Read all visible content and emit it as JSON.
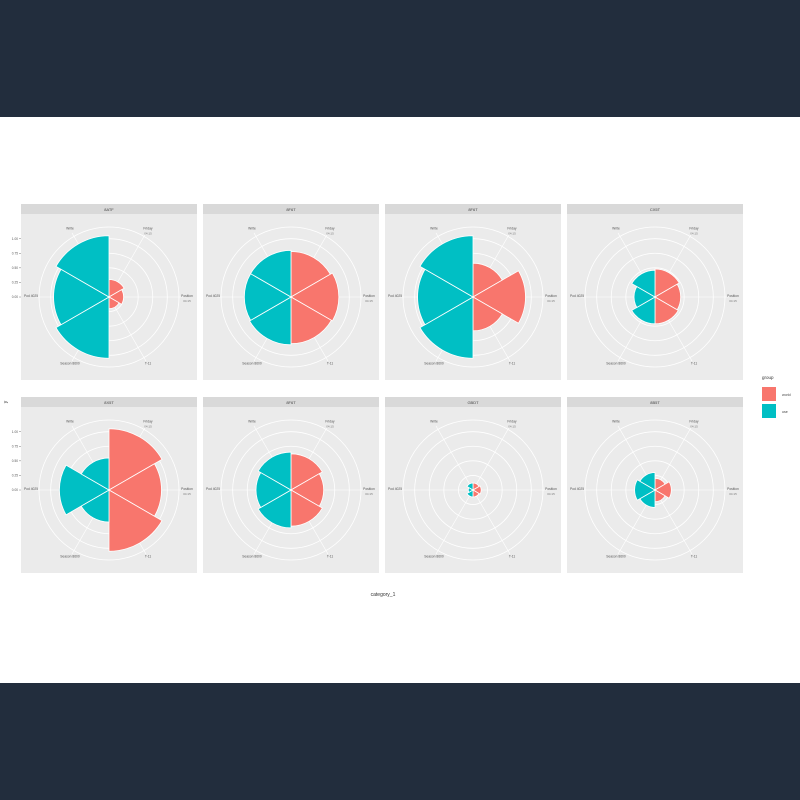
{
  "colors": {
    "page_background": "#222d3d",
    "panel_background": "#ebebeb",
    "strip_background": "#d9d9d9",
    "gridline": "#ffffff",
    "series_a": "#f8766d",
    "series_b": "#00bfc4"
  },
  "chart_data": {
    "type": "polar bar (coxcomb), faceted 2x4",
    "xlabel": "category_1",
    "ylabel": "y",
    "radial_ticks": [
      "0.00",
      "0.25",
      "0.50",
      "0.75",
      "1.00"
    ],
    "ylim": [
      0,
      1.2
    ],
    "legend": {
      "title": "group",
      "placement": "right",
      "entries": [
        {
          "label": "world",
          "color": "#f8766d"
        },
        {
          "label": "use",
          "color": "#00bfc4"
        }
      ]
    },
    "angular_labels": [
      {
        "label": "Friday",
        "sublabel": "04:15"
      },
      {
        "label": "Position",
        "sublabel": "04:15"
      },
      {
        "label": "T-11",
        "sublabel": ""
      },
      {
        "label": "Season 8600",
        "sublabel": ""
      },
      {
        "label": "Pod 4025",
        "sublabel": ""
      },
      {
        "label": "Write",
        "sublabel": ""
      }
    ],
    "categories": [
      "Friday",
      "Position",
      "T-11",
      "Season 8600",
      "Pod 4025",
      "Write"
    ],
    "facets": [
      {
        "title": "8ATF",
        "series": [
          {
            "name": "world",
            "values": [
              0.3,
              0.25,
              0.2,
              0,
              0,
              0
            ]
          },
          {
            "name": "use",
            "values": [
              0,
              0,
              0,
              1.05,
              0.95,
              1.05
            ]
          }
        ]
      },
      {
        "title": "8F6T",
        "series": [
          {
            "name": "world",
            "values": [
              0.78,
              0.82,
              0.8,
              0,
              0,
              0
            ]
          },
          {
            "name": "use",
            "values": [
              0,
              0,
              0,
              0.82,
              0.8,
              0.8
            ]
          }
        ]
      },
      {
        "title": "8F6T",
        "series": [
          {
            "name": "world",
            "values": [
              0.58,
              0.9,
              0.58,
              0,
              0,
              0
            ]
          },
          {
            "name": "use",
            "values": [
              0,
              0,
              0,
              1.05,
              0.95,
              1.05
            ]
          }
        ]
      },
      {
        "title": "CX5T",
        "series": [
          {
            "name": "world",
            "values": [
              0.48,
              0.44,
              0.46,
              0,
              0,
              0
            ]
          },
          {
            "name": "use",
            "values": [
              0,
              0,
              0,
              0.46,
              0.36,
              0.46
            ]
          }
        ]
      },
      {
        "title": "8X5T",
        "series": [
          {
            "name": "world",
            "values": [
              1.05,
              0.9,
              1.05,
              0,
              0,
              0
            ]
          },
          {
            "name": "use",
            "values": [
              0,
              0,
              0,
              0.55,
              0.85,
              0.55
            ]
          }
        ]
      },
      {
        "title": "8F6T",
        "series": [
          {
            "name": "world",
            "values": [
              0.62,
              0.56,
              0.62,
              0,
              0,
              0
            ]
          },
          {
            "name": "use",
            "values": [
              0,
              0,
              0,
              0.65,
              0.6,
              0.65
            ]
          }
        ]
      },
      {
        "title": "GBDT",
        "series": [
          {
            "name": "world",
            "values": [
              0.12,
              0.14,
              0.12,
              0,
              0,
              0
            ]
          },
          {
            "name": "use",
            "values": [
              0,
              0,
              0,
              0.12,
              0.08,
              0.12
            ]
          }
        ]
      },
      {
        "title": "8B5T",
        "series": [
          {
            "name": "world",
            "values": [
              0.2,
              0.28,
              0.2,
              0,
              0,
              0
            ]
          },
          {
            "name": "use",
            "values": [
              0,
              0,
              0,
              0.3,
              0.35,
              0.3
            ]
          }
        ]
      }
    ]
  }
}
